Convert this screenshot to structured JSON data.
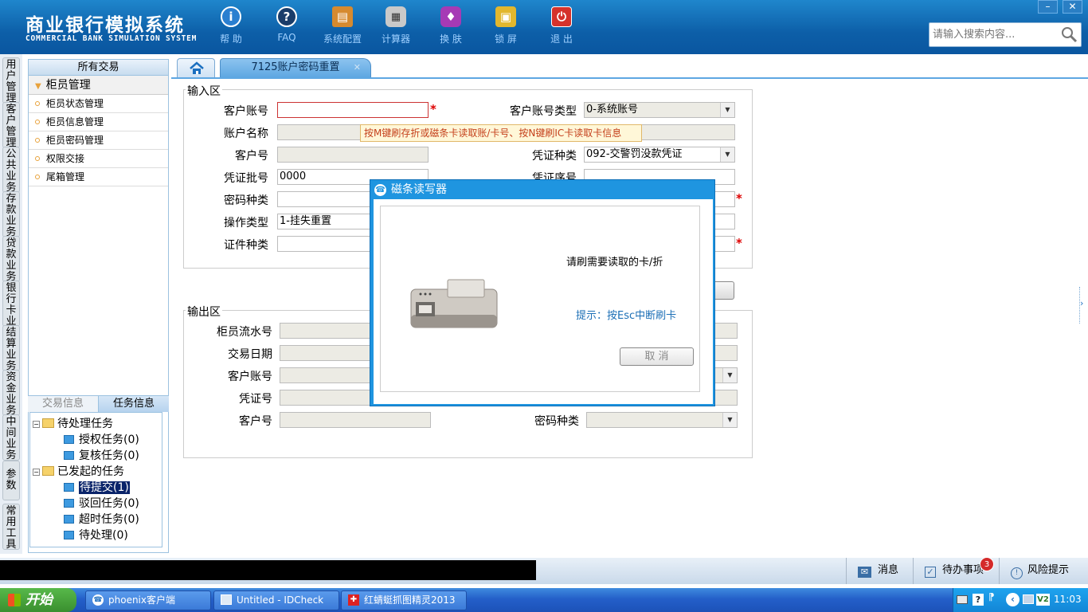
{
  "header": {
    "title_cn": "商业银行模拟系统",
    "title_en": "COMMERCIAL BANK SIMULATION SYSTEM",
    "tools": [
      {
        "label": "帮 助",
        "icon": "help-icon"
      },
      {
        "label": "FAQ",
        "icon": "faq-icon"
      },
      {
        "label": "系统配置",
        "icon": "toolbox-icon"
      },
      {
        "label": "计算器",
        "icon": "calculator-icon"
      },
      {
        "label": "换 肤",
        "icon": "skin-icon"
      },
      {
        "label": "锁 屏",
        "icon": "lock-icon"
      },
      {
        "label": "退 出",
        "icon": "power-icon"
      }
    ],
    "search_placeholder": "请输入搜索内容..."
  },
  "vtabs": [
    "用户管理",
    "客户管理",
    "公共业务",
    "存款业务",
    "贷款业务",
    "银行卡业务",
    "结算业务",
    "资金业务",
    "中间业务",
    "参数",
    "常用工具"
  ],
  "left_panel": {
    "header": "所有交易",
    "group": "柜员管理",
    "items": [
      "柜员状态管理",
      "柜员信息管理",
      "柜员密码管理",
      "权限交接",
      "尾箱管理"
    ],
    "tabs": [
      "交易信息",
      "任务信息"
    ],
    "tree": {
      "pending": "待处理任务",
      "pending_children": [
        "授权任务(0)",
        "复核任务(0)"
      ],
      "initiated": "已发起的任务",
      "initiated_children": [
        "待提交(1)",
        "驳回任务(0)",
        "超时任务(0)",
        "待处理(0)"
      ]
    }
  },
  "main_tab": "7125账户密码重置",
  "input_area": {
    "legend": "输入区",
    "labels": {
      "cust_account": "客户账号",
      "account_type": "客户账号类型",
      "account_name": "账户名称",
      "cust_no": "客户号",
      "voucher_type": "凭证种类",
      "voucher_batch": "凭证批号",
      "voucher_seq": "凭证序号",
      "pwd_type": "密码种类",
      "op_type": "操作类型",
      "id_type": "证件种类"
    },
    "values": {
      "account_type": "0-系统账号",
      "voucher_type": "092-交警罚没款凭证",
      "voucher_batch": "0000",
      "op_type": "1-挂失重置"
    },
    "tooltip": "按M键刷存折或磁条卡读取账/卡号、按N键刷IC卡读取卡信息"
  },
  "output_area": {
    "legend": "输出区",
    "labels": {
      "teller_serial": "柜员流水号",
      "trade_date": "交易日期",
      "cust_account": "客户账号",
      "voucher": "凭证号",
      "cust_no": "客户号",
      "pwd_type": "密码种类"
    }
  },
  "dialog": {
    "title": "磁条读写器",
    "message": "请刷需要读取的卡/折",
    "hint": "提示：按Esc中断刷卡",
    "cancel": "取 消"
  },
  "statusbar": {
    "messages": "消息",
    "todo": "待办事项",
    "todo_count": "3",
    "risk": "风险提示"
  },
  "taskbar": {
    "start": "开始",
    "tasks": [
      "phoenix客户端",
      "Untitled - IDCheck",
      "红蜻蜓抓图精灵2013"
    ],
    "time": "11:03"
  },
  "colors": {
    "header_blue": "#0d5fa8",
    "dialog_blue": "#1f95e0",
    "required_red": "#dd0000"
  }
}
